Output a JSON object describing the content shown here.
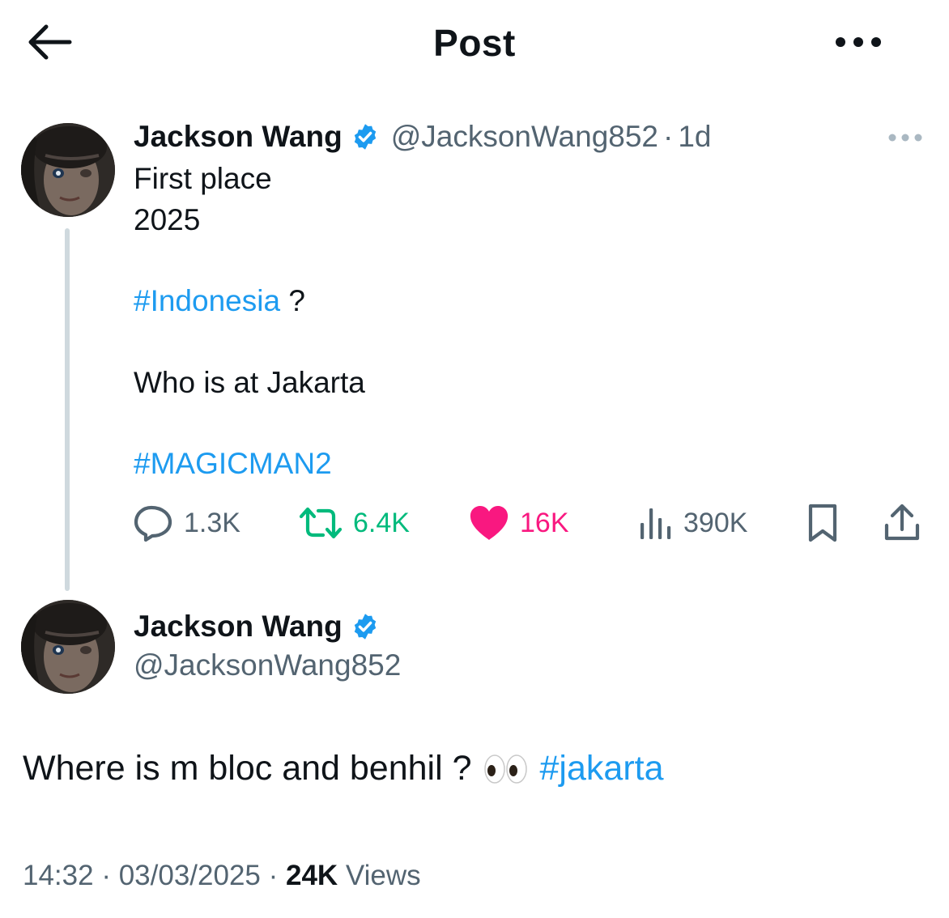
{
  "header": {
    "title": "Post",
    "back_icon": "arrow-left-icon",
    "more_icon": "more-horizontal-icon"
  },
  "tweet": {
    "display_name": "Jackson Wang",
    "handle": "@JacksonWang852",
    "separator": "·",
    "time": "1d",
    "lines": {
      "line1": "First place",
      "line2": "2025",
      "hashtag1": "#Indonesia",
      "after_hashtag1": " ?",
      "line4": "Who is at Jakarta",
      "hashtag2": "#MAGICMAN2"
    },
    "actions": {
      "reply_count": "1.3K",
      "retweet_count": "6.4K",
      "like_count": "16K",
      "views_count": "390K"
    },
    "colors": {
      "link": "#1d9bf0",
      "retweet": "#00ba7c",
      "like": "#f91880",
      "muted": "#536471"
    }
  },
  "reply": {
    "display_name": "Jackson Wang",
    "handle": "@JacksonWang852",
    "text": "Where is m bloc and benhil ?",
    "emoji": "eyes-emoji",
    "hashtag": "#jakarta"
  },
  "meta": {
    "time": "14:32",
    "sep1": " · ",
    "date": "03/03/2025",
    "sep2": " · ",
    "views": "24K",
    "views_label": " Views"
  }
}
